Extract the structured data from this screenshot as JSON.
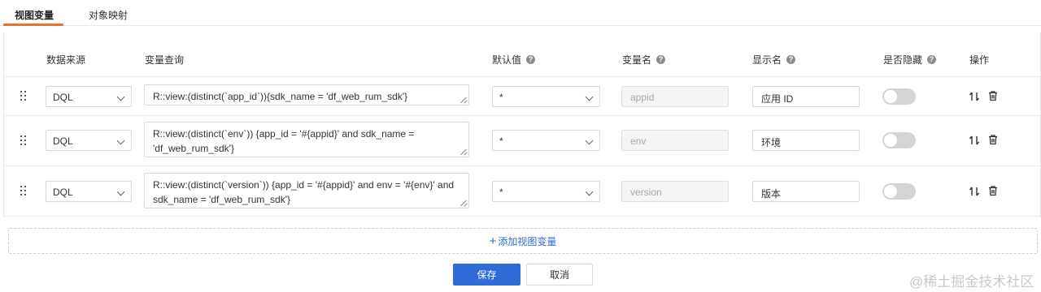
{
  "tabs": [
    {
      "label": "视图变量",
      "active": true
    },
    {
      "label": "对象映射",
      "active": false
    }
  ],
  "table": {
    "headers": {
      "source": "数据来源",
      "query": "变量查询",
      "default": "默认值",
      "var_name": "变量名",
      "display_name": "显示名",
      "hidden": "是否隐藏",
      "actions": "操作"
    },
    "help_icon": "?",
    "rows": [
      {
        "source": "DQL",
        "query": "R::view:(distinct(`app_id`)){sdk_name = 'df_web_rum_sdk'}",
        "default": "*",
        "var_name": "appid",
        "display_name": "应用 ID",
        "hidden": false
      },
      {
        "source": "DQL",
        "query": "R::view:(distinct(`env`)) {app_id = '#{appid}' and sdk_name = 'df_web_rum_sdk'}",
        "default": "*",
        "var_name": "env",
        "display_name": "环境",
        "hidden": false
      },
      {
        "source": "DQL",
        "query": "R::view:(distinct(`version`)) {app_id = '#{appid}' and env = '#{env}'  and sdk_name = 'df_web_rum_sdk'}",
        "default": "*",
        "var_name": "version",
        "display_name": "版本",
        "hidden": false
      }
    ]
  },
  "add_variable_label": "添加视图变量",
  "add_variable_plus": "+",
  "footer": {
    "save_label": "保存",
    "cancel_label": "取消"
  },
  "watermark": "@稀土掘金技术社区",
  "colors": {
    "accent_tab": "#f06d2b",
    "primary": "#2f6bd6",
    "border": "#d9d9d9"
  },
  "icons": [
    "drag-handle-icon",
    "chevron-down-icon",
    "help-icon",
    "sort-icon",
    "trash-icon"
  ]
}
